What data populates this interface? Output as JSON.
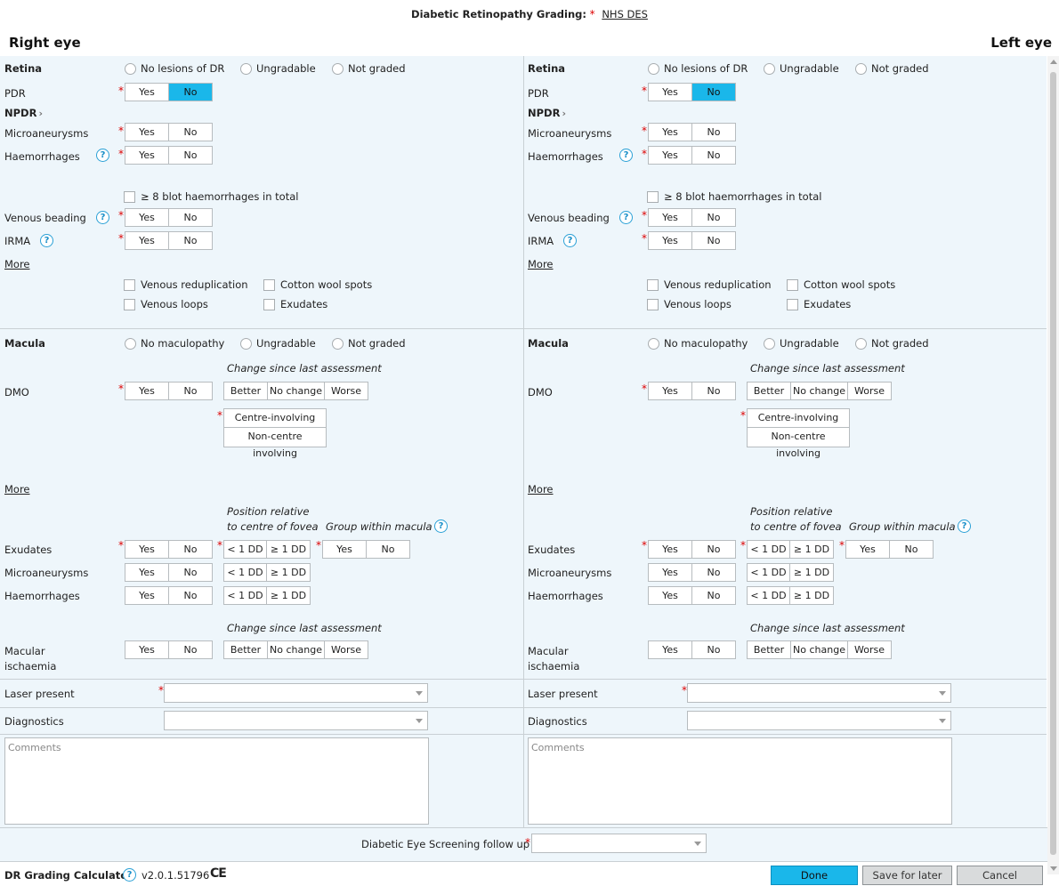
{
  "header": {
    "title": "Diabetic Retinopathy Grading:",
    "star": "*",
    "link": "NHS DES"
  },
  "right_title": "Right eye",
  "left_title": "Left eye",
  "labels": {
    "retina": "Retina",
    "no_lesions": "No lesions of DR",
    "ungradable": "Ungradable",
    "not_graded": "Not graded",
    "pdr": "PDR",
    "npdr": "NPDR",
    "microaneurysms": "Microaneurysms",
    "haemorrhages": "Haemorrhages",
    "blot": "≥ 8 blot haemorrhages in total",
    "venous_beading": "Venous beading",
    "irma": "IRMA",
    "more": "More",
    "venous_reduplication": "Venous reduplication",
    "cotton_wool": "Cotton wool spots",
    "venous_loops": "Venous loops",
    "exudates_chk": "Exudates",
    "macula": "Macula",
    "no_maculopathy": "No maculopathy",
    "change_since": "Change since last assessment",
    "dmo": "DMO",
    "centre_involving": "Centre-involving",
    "non_centre": "Non-centre involving",
    "position_relative": "Position relative",
    "to_centre": "to centre of fovea",
    "group_within": "Group within macula",
    "exudates": "Exudates",
    "macular": "Macular",
    "ischaemia": "ischaemia",
    "laser_present": "Laser present",
    "diagnostics": "Diagnostics",
    "comments": "Comments",
    "yes": "Yes",
    "no": "No",
    "better": "Better",
    "no_change": "No change",
    "worse": "Worse",
    "lt1dd": "< 1 DD",
    "ge1dd": "≥ 1 DD",
    "help": "?",
    "star": "*"
  },
  "right_eye": {
    "pdr_selected": "No"
  },
  "left_eye": {
    "pdr_selected": "No"
  },
  "footer": {
    "followup_label": "Diabetic Eye Screening follow up",
    "calc_label": "DR Grading Calculator",
    "version": "v2.0.1.51796",
    "ce_mark": "CE",
    "done": "Done",
    "save_later": "Save for later",
    "cancel": "Cancel"
  }
}
